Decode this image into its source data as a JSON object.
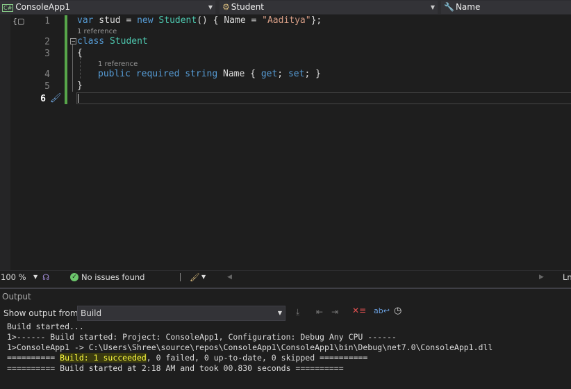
{
  "nav": {
    "project": "ConsoleApp1",
    "type": "Student",
    "member": "Name",
    "cs_badge": "C#"
  },
  "editor": {
    "line_numbers": [
      "1",
      "2",
      "3",
      "4",
      "5",
      "6"
    ],
    "line1": {
      "kw1": "var",
      "id": " stud = ",
      "kw2": "new",
      "ty": " Student",
      "rest1": "() { Name = ",
      "str": "\"Aaditya\"",
      "rest2": "};"
    },
    "ref1": "1 reference",
    "line2": {
      "kw": "class",
      "ty": " Student"
    },
    "line3": "{",
    "ref2": "1 reference",
    "line4": {
      "kw": "public required string",
      "rest1": " Name { ",
      "get": "get",
      "mid": "; ",
      "set": "set",
      "rest2": "; }"
    },
    "line5": "}"
  },
  "status": {
    "zoom": "100 %",
    "issues": "No issues found",
    "position": "Ln"
  },
  "output": {
    "title": "Output",
    "show_from_label": "Show output from:",
    "source": "Build",
    "lines": [
      "Build started...",
      "1>------ Build started: Project: ConsoleApp1, Configuration: Debug Any CPU ------",
      "1>ConsoleApp1 -> C:\\Users\\Shree\\source\\repos\\ConsoleApp1\\ConsoleApp1\\bin\\Debug\\net7.0\\ConsoleApp1.dll"
    ],
    "summary_prefix": "========== ",
    "summary_highlight": "Build: 1 succeeded",
    "summary_rest": ", 0 failed, 0 up-to-date, 0 skipped ==========",
    "timing": "========== Build started at 2:18 AM and took 00.830 seconds =========="
  }
}
